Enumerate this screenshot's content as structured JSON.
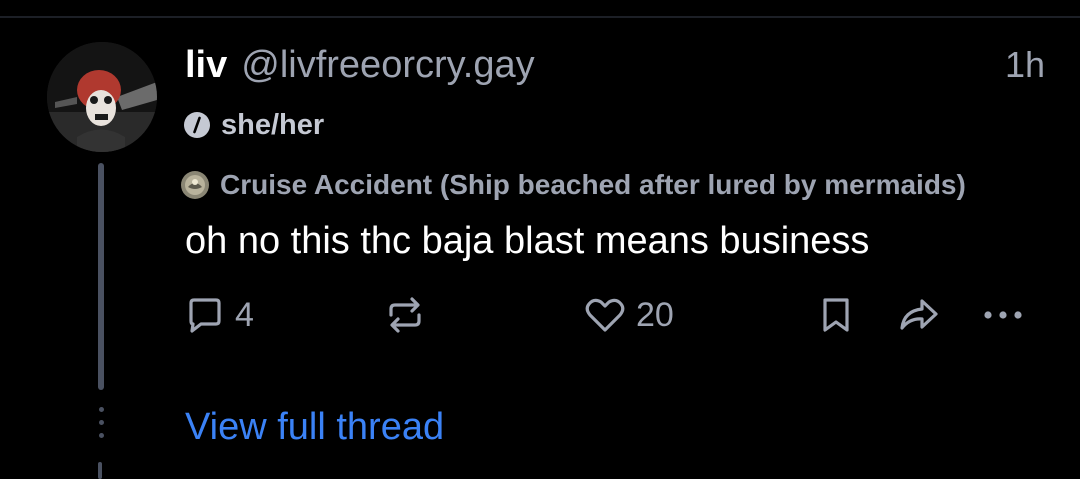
{
  "post": {
    "author": {
      "display_name": "liv",
      "handle": "@livfreeorcry.gay",
      "pronouns": "she/her",
      "avatar_icon": "avatar-skull-face"
    },
    "timestamp": "1h",
    "label": {
      "icon": "label-badge-icon",
      "text": "Cruise Accident (Ship beached after lured by mermaids)"
    },
    "text": "oh no this thc baja blast means business",
    "actions": {
      "reply_count": "4",
      "repost_count": "",
      "like_count": "20"
    }
  },
  "thread": {
    "view_full_label": "View full thread"
  },
  "colors": {
    "background": "#000000",
    "text_primary": "#ffffff",
    "text_secondary": "#9ea4b2",
    "link": "#3b82f6",
    "thread_line": "#4a5161"
  }
}
